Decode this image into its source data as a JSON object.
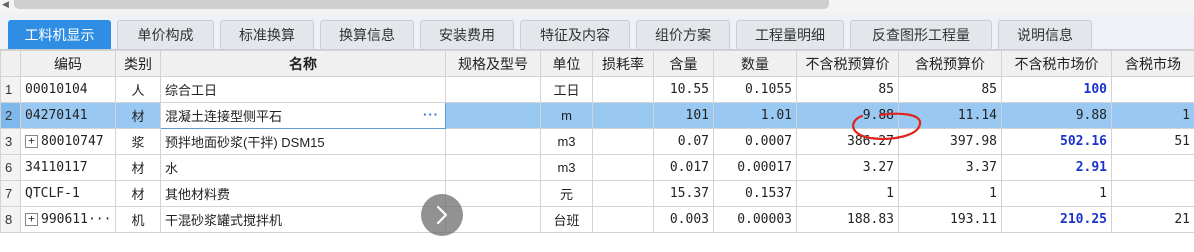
{
  "tabs": [
    {
      "label": "工料机显示",
      "active": true
    },
    {
      "label": "单价构成"
    },
    {
      "label": "标准换算"
    },
    {
      "label": "换算信息"
    },
    {
      "label": "安装费用"
    },
    {
      "label": "特征及内容"
    },
    {
      "label": "组价方案"
    },
    {
      "label": "工程量明细"
    },
    {
      "label": "反查图形工程量"
    },
    {
      "label": "说明信息"
    }
  ],
  "columns": [
    "编码",
    "类别",
    "名称",
    "规格及型号",
    "单位",
    "损耗率",
    "含量",
    "数量",
    "不含税预算价",
    "含税预算价",
    "不含税市场价",
    "含税市场"
  ],
  "rows": [
    {
      "num": "1",
      "code": "00010104",
      "cat": "人",
      "name": "综合工日",
      "spec": "",
      "unit": "工日",
      "loss": "",
      "content": "10.55",
      "qty": "0.1055",
      "nt_budget": "85",
      "t_budget": "85",
      "nt_market": "100",
      "t_market": ""
    },
    {
      "num": "2",
      "code": "04270141",
      "cat": "材",
      "name": "混凝土连接型侧平石",
      "spec": "",
      "unit": "m",
      "loss": "",
      "content": "101",
      "qty": "1.01",
      "nt_budget": "9.88",
      "t_budget": "11.14",
      "nt_market": "9.88",
      "t_market": "1",
      "selected": true
    },
    {
      "num": "3",
      "code": "80010747",
      "cat": "浆",
      "name": "预拌地面砂浆(干拌) DSM15",
      "spec": "",
      "unit": "m3",
      "loss": "",
      "content": "0.07",
      "qty": "0.0007",
      "nt_budget": "386.27",
      "t_budget": "397.98",
      "nt_market": "502.16",
      "t_market": "51",
      "expand": true
    },
    {
      "num": "6",
      "code": "34110117",
      "cat": "材",
      "name": "水",
      "spec": "",
      "unit": "m3",
      "loss": "",
      "content": "0.017",
      "qty": "0.00017",
      "nt_budget": "3.27",
      "t_budget": "3.37",
      "nt_market": "2.91",
      "t_market": ""
    },
    {
      "num": "7",
      "code": "QTCLF-1",
      "cat": "材",
      "name": "其他材料费",
      "spec": "",
      "unit": "元",
      "loss": "",
      "content": "15.37",
      "qty": "0.1537",
      "nt_budget": "1",
      "t_budget": "1",
      "nt_market": "1",
      "t_market": ""
    },
    {
      "num": "8",
      "code": "990611···",
      "cat": "机",
      "name": "干混砂浆罐式搅拌机",
      "spec": "",
      "unit": "台班",
      "loss": "",
      "content": "0.003",
      "qty": "0.00003",
      "nt_budget": "188.83",
      "t_budget": "193.11",
      "nt_market": "210.25",
      "t_market": "21",
      "expand": true
    }
  ],
  "edit_button_label": "···",
  "icons": {
    "next": "chevron-right-icon",
    "expand": "plus-box-icon"
  },
  "colors": {
    "tab_active": "#2f8ee3",
    "selected_row": "#99c9f2",
    "market_price": "#1a33cc",
    "annotation": "#e0241d"
  }
}
